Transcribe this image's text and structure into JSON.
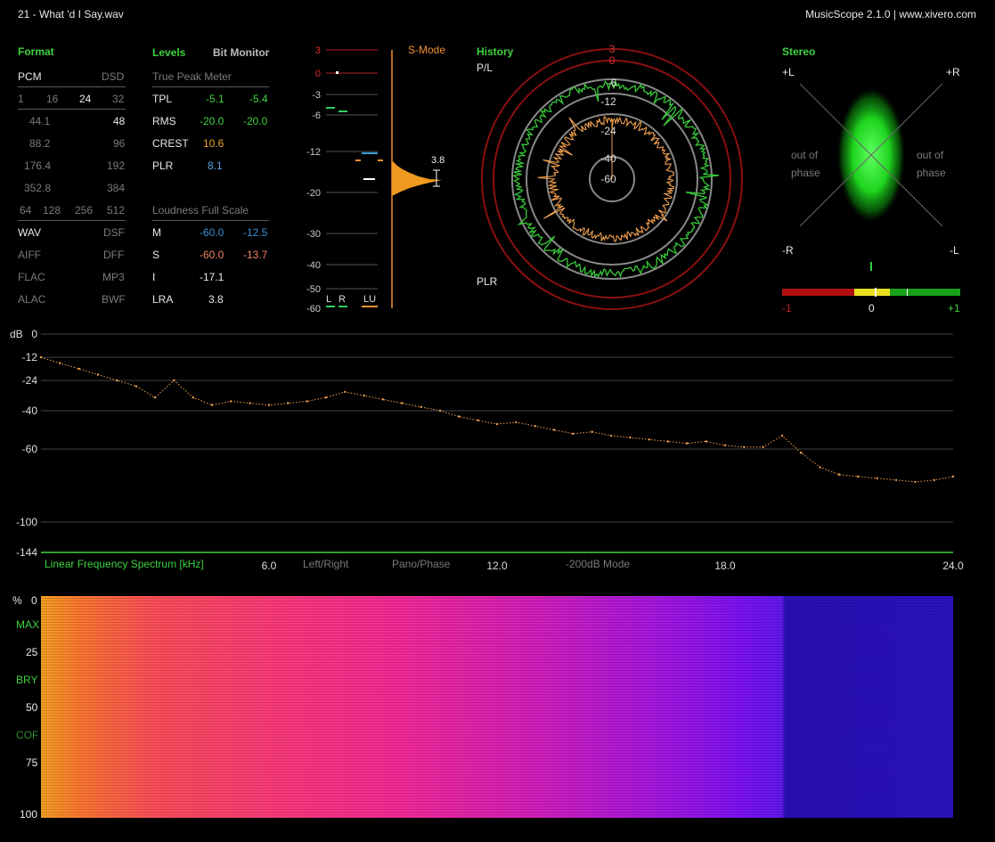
{
  "window": {
    "file_title": "21 - What 'd I Say.wav",
    "app_title": "MusicScope 2.1.0 | www.xivero.com"
  },
  "format": {
    "header": "Format",
    "pcm": "PCM",
    "dsd": "DSD",
    "bit_depths": [
      "1",
      "16",
      "24",
      "32"
    ],
    "rates_pcm": [
      "44.1",
      "88.2",
      "176.4",
      "352.8"
    ],
    "rates_dsd": [
      "48",
      "96",
      "192",
      "384"
    ],
    "dsd_rates": [
      "64",
      "128",
      "256",
      "512"
    ],
    "containers_left": [
      "WAV",
      "AIFF",
      "FLAC",
      "ALAC"
    ],
    "containers_right": [
      "DSF",
      "DFF",
      "MP3",
      "BWF"
    ]
  },
  "levels": {
    "header": "Levels",
    "bit_monitor": "Bit Monitor",
    "true_peak_label": "True Peak Meter",
    "rows": [
      {
        "label": "TPL",
        "l": "-5.1",
        "r": "-5.4"
      },
      {
        "label": "RMS",
        "l": "-20.0",
        "r": "-20.0"
      },
      {
        "label": "CREST",
        "l": "10.6"
      },
      {
        "label": "PLR",
        "l": "8.1"
      }
    ],
    "loudness_label": "Loudness Full Scale",
    "loud_rows": [
      {
        "label": "M",
        "a": "-60.0",
        "b": "-12.5"
      },
      {
        "label": "S",
        "a": "-60.0",
        "b": "-13.7"
      },
      {
        "label": "I",
        "a": "-17.1"
      },
      {
        "label": "LRA",
        "a": "3.8"
      }
    ]
  },
  "meter": {
    "scale": [
      "3",
      "0",
      "-3",
      "-6",
      "-12",
      "-20",
      "-30",
      "-40",
      "-50",
      "-60"
    ],
    "smode": "S-Mode",
    "lra_value": "3.8",
    "channels": [
      "L",
      "R",
      "LU"
    ]
  },
  "history": {
    "header": "History",
    "pl_label": "P/L",
    "plr_label": "PLR",
    "ring_labels": [
      "3",
      "0",
      "-6",
      "-12",
      "-24",
      "-40",
      "-60"
    ]
  },
  "stereo": {
    "header": "Stereo",
    "plus_l": "+L",
    "plus_r": "+R",
    "minus_r": "-R",
    "minus_l": "-L",
    "out_of_phase": "out of phase",
    "corr_min": "-1",
    "corr_mid": "0",
    "corr_max": "+1",
    "correlation": 0.05
  },
  "spectrum": {
    "y_unit": "dB",
    "y_ticks": [
      "0",
      "-12",
      "-24",
      "-40",
      "-60",
      "-100",
      "-144"
    ],
    "title": "Linear Frequency Spectrum [kHz]",
    "x_ticks": [
      "6.0",
      "12.0",
      "18.0",
      "24.0"
    ],
    "buttons": [
      "Left/Right",
      "Pano/Phase",
      "-200dB Mode"
    ]
  },
  "spectrogram": {
    "y_unit": "%",
    "y_ticks": [
      "0",
      "25",
      "50",
      "75",
      "100"
    ],
    "markers": [
      "MAX",
      "BRY",
      "COF"
    ]
  },
  "chart_data": {
    "type": "line",
    "x": [
      0,
      0.5,
      1,
      1.5,
      2,
      2.5,
      3,
      3.5,
      4,
      4.5,
      5,
      5.5,
      6,
      6.5,
      7,
      7.5,
      8,
      8.5,
      9,
      9.5,
      10,
      10.5,
      11,
      11.5,
      12,
      12.5,
      13,
      13.5,
      14,
      14.5,
      15,
      15.5,
      16,
      16.5,
      17,
      17.5,
      18,
      18.5,
      19,
      19.5,
      20,
      20.5,
      21,
      21.5,
      22,
      22.5,
      23,
      23.5,
      24
    ],
    "series": [
      {
        "values": [
          -12,
          -15,
          -18,
          -21,
          -24,
          -27,
          -33,
          -24,
          -33,
          -37,
          -35,
          -36,
          -37,
          -36,
          -35,
          -33,
          -30,
          -32,
          -34,
          -36,
          -38,
          -40,
          -43,
          -45,
          -47,
          -46,
          -48,
          -50,
          -52,
          -51,
          -53,
          -54,
          -55,
          -56,
          -57,
          -56,
          -58,
          -59,
          -59,
          -53,
          -62,
          -70,
          -74,
          -75,
          -76,
          -77,
          -78,
          -77,
          -75
        ]
      }
    ],
    "xlabel": "Linear Frequency Spectrum [kHz]",
    "ylabel": "dB",
    "xlim": [
      0,
      24
    ],
    "ylim": [
      -144,
      0
    ],
    "y_ticks": [
      0,
      -12,
      -24,
      -40,
      -60,
      -100,
      -144
    ]
  },
  "colors": {
    "accent_green": "#3fd23f",
    "spectrum_line": "#f0a050",
    "ring_red": "#9a1010"
  }
}
